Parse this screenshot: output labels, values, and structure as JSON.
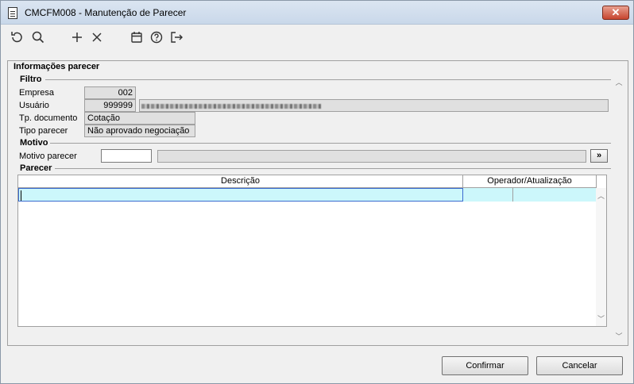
{
  "window": {
    "title": "CMCFM008 - Manutenção de Parecer",
    "close_glyph": "✕"
  },
  "toolbar": {
    "icons": [
      "refresh-icon",
      "search-icon",
      "add-icon",
      "delete-icon",
      "calendar-icon",
      "help-icon",
      "exit-icon"
    ]
  },
  "group": {
    "title": "Informações parecer"
  },
  "filtro": {
    "legend": "Filtro",
    "empresa_label": "Empresa",
    "empresa_value": "002",
    "usuario_label": "Usuário",
    "usuario_value": "999999",
    "tp_documento_label": "Tp. documento",
    "tp_documento_value": "Cotação",
    "tipo_parecer_label": "Tipo parecer",
    "tipo_parecer_value": "Não aprovado negociação"
  },
  "motivo": {
    "legend": "Motivo",
    "motivo_parecer_label": "Motivo parecer",
    "lookup_label": "»"
  },
  "parecer": {
    "legend": "Parecer",
    "columns": [
      "Descrição",
      "Operador/Atualização"
    ]
  },
  "buttons": {
    "confirm": "Confirmar",
    "cancel": "Cancelar"
  }
}
